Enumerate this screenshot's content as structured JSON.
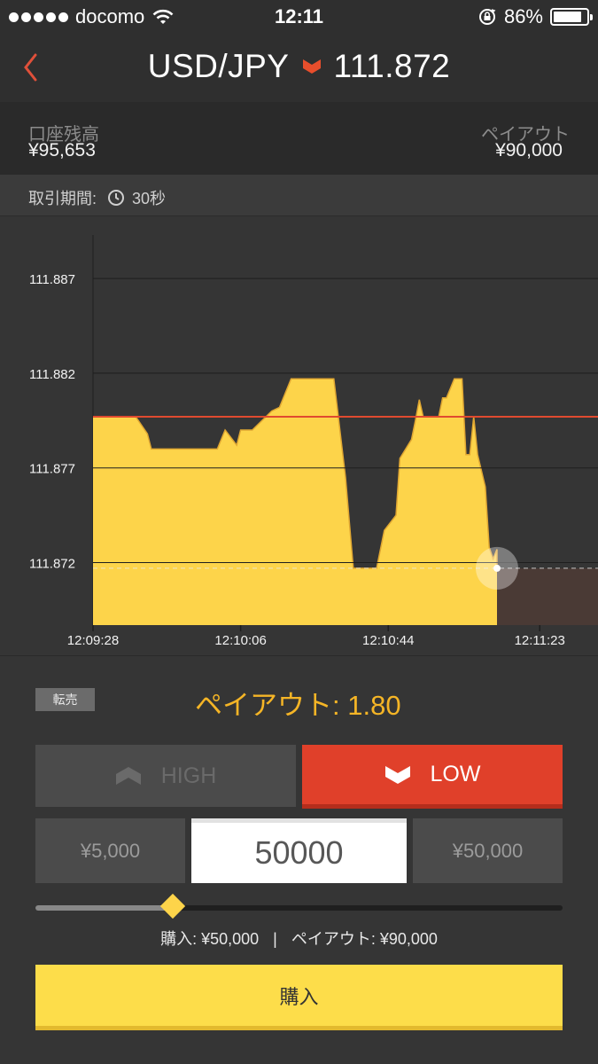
{
  "status_bar": {
    "carrier": "docomo",
    "time": "12:11",
    "battery": "86%",
    "battery_level": 0.86,
    "icons": [
      "signal-dots-icon",
      "wifi-icon",
      "rotation-lock-icon",
      "battery-icon"
    ]
  },
  "header": {
    "pair": "USD/JPY",
    "direction_icon": "down-chevron-icon",
    "price": "111.872",
    "back_icon": "back-chevron-icon"
  },
  "account": {
    "balance_label": "口座残高",
    "balance_value": "¥95,653",
    "payout_label": "ペイアウト",
    "payout_value": "¥90,000"
  },
  "period": {
    "label": "取引期間:",
    "icon": "clock-icon",
    "value": "30秒"
  },
  "chart_data": {
    "type": "area",
    "y_ticks": [
      "111.887",
      "111.882",
      "111.877",
      "111.872"
    ],
    "x_ticks": [
      "12:09:28",
      "12:10:06",
      "12:10:44",
      "12:11:23"
    ],
    "ylim": [
      111.8687,
      111.8893
    ],
    "xlim": [
      "12:09:28",
      "12:11:38"
    ],
    "strike_price": 111.8797,
    "current_price": 111.8717,
    "current_time": "12:11:12",
    "expiry_time": "12:11:43",
    "grid": true,
    "series": [
      {
        "points": [
          [
            "12:09:28",
            111.8797
          ],
          [
            "12:09:39",
            111.8797
          ],
          [
            "12:09:42",
            111.8788
          ],
          [
            "12:09:43",
            111.878
          ],
          [
            "12:10:00",
            111.878
          ],
          [
            "12:10:02",
            111.879
          ],
          [
            "12:10:05",
            111.8782
          ],
          [
            "12:10:06",
            111.879
          ],
          [
            "12:10:09",
            111.879
          ],
          [
            "12:10:14",
            111.88
          ],
          [
            "12:10:16",
            111.8802
          ],
          [
            "12:10:19",
            111.8817
          ],
          [
            "12:10:30",
            111.8817
          ],
          [
            "12:10:33",
            111.8765
          ],
          [
            "12:10:35",
            111.8717
          ],
          [
            "12:10:41",
            111.8717
          ],
          [
            "12:10:43",
            111.8737
          ],
          [
            "12:10:46",
            111.8745
          ],
          [
            "12:10:47",
            111.8775
          ],
          [
            "12:10:50",
            111.8785
          ],
          [
            "12:10:51",
            111.8795
          ],
          [
            "12:10:52",
            111.8806
          ],
          [
            "12:10:53",
            111.8797
          ],
          [
            "12:10:57",
            111.8797
          ],
          [
            "12:10:58",
            111.8807
          ],
          [
            "12:10:59",
            111.8807
          ],
          [
            "12:11:01",
            111.8817
          ],
          [
            "12:11:03",
            111.8817
          ],
          [
            "12:11:04",
            111.8777
          ],
          [
            "12:11:05",
            111.8777
          ],
          [
            "12:11:06",
            111.8797
          ],
          [
            "12:11:07",
            111.8777
          ],
          [
            "12:11:09",
            111.876
          ],
          [
            "12:11:10",
            111.8728
          ],
          [
            "12:11:11",
            111.8722
          ],
          [
            "12:11:12",
            111.8727
          ],
          [
            "12:11:12",
            111.8717
          ]
        ]
      }
    ]
  },
  "trade": {
    "resell_label": "転売",
    "payout_rate_label": "ペイアウト: 1.80",
    "high_label": "HIGH",
    "low_label": "LOW",
    "amount_min": "¥5,000",
    "amount_value": "50000",
    "amount_max": "¥50,000",
    "slider_value": 0.26,
    "summary_purchase": "購入: ¥50,000",
    "summary_separator": "|",
    "summary_payout": "ペイアウト: ¥90,000",
    "buy_label": "購入"
  },
  "colors": {
    "area_fill": "#fdd44a",
    "area_stroke": "#e0a732",
    "strike_line": "#e04a2f",
    "low_button": "#e0402a",
    "accent_text": "#f5b526",
    "expiry_zone": "#4a3a35"
  }
}
